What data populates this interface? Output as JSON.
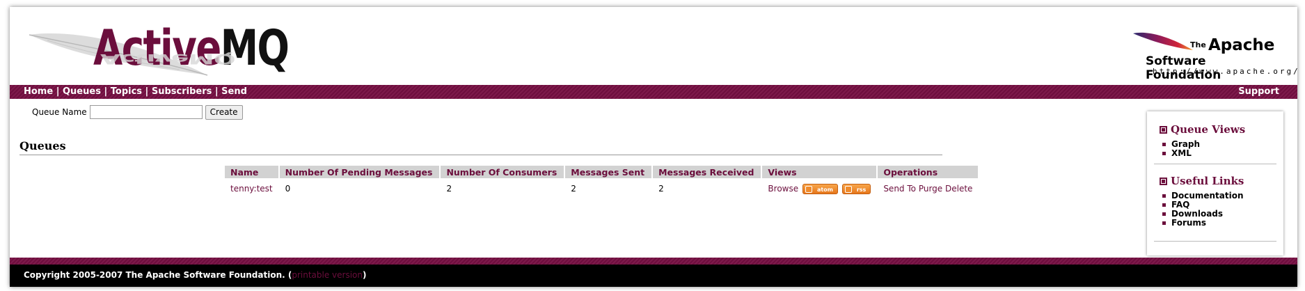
{
  "header": {
    "logo": {
      "part1": "Active",
      "part2": "MQ",
      "shadow": "ActiveMQ"
    },
    "apache": {
      "the": "The",
      "name": "Apache",
      "foundation": "Software Foundation",
      "url": "http://www.apache.org/"
    }
  },
  "nav": {
    "items": [
      "Home",
      "Queues",
      "Topics",
      "Subscribers",
      "Send"
    ],
    "separator": " | ",
    "support": "Support"
  },
  "form": {
    "label": "Queue Name",
    "value": "",
    "placeholder": "",
    "button": "Create"
  },
  "page_title": "Queues",
  "table": {
    "headers": [
      "Name",
      "Number Of Pending Messages",
      "Number Of Consumers",
      "Messages Sent",
      "Messages Received",
      "Views",
      "Operations"
    ],
    "rows": [
      {
        "name": "tenny:test",
        "pending": "0",
        "consumers": "2",
        "sent": "2",
        "received": "2",
        "views": {
          "browse": "Browse",
          "atom": "atom",
          "rss": "rss"
        },
        "operations": {
          "send": "Send To",
          "purge": "Purge",
          "delete": "Delete"
        }
      }
    ]
  },
  "sidebar": {
    "queue_views": {
      "title": "Queue Views",
      "items": [
        "Graph",
        "XML"
      ]
    },
    "useful_links": {
      "title": "Useful Links",
      "items": [
        "Documentation",
        "FAQ",
        "Downloads",
        "Forums"
      ]
    }
  },
  "footer": {
    "copyright": "Copyright 2005-2007 The Apache Software Foundation. (",
    "printable": "printable version",
    "close": ")"
  },
  "colors": {
    "brand": "#6b0e3c",
    "header_bg": "#d2d2d2",
    "footer_bg": "#000000"
  }
}
